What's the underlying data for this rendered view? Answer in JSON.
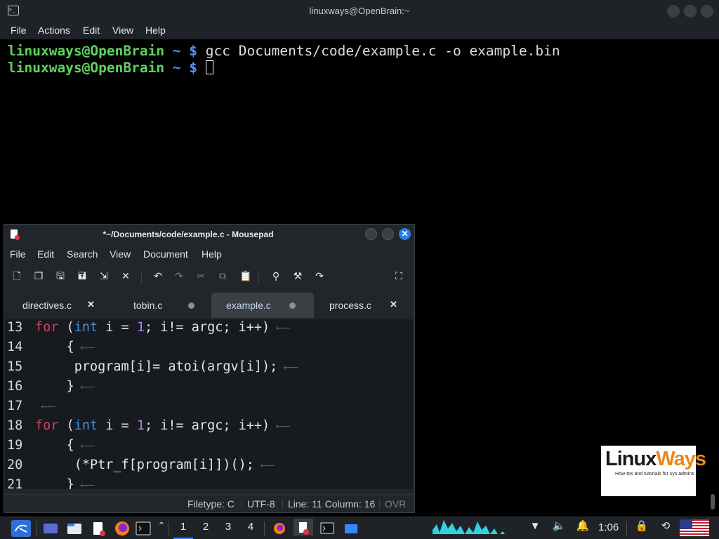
{
  "terminal": {
    "title": "linuxways@OpenBrain:~",
    "menu": [
      "File",
      "Actions",
      "Edit",
      "View",
      "Help"
    ],
    "lines": [
      {
        "user": "linuxways@OpenBrain",
        "path": " ~ $ ",
        "command": "gcc Documents/code/example.c -o example.bin"
      },
      {
        "user": "linuxways@OpenBrain",
        "path": " ~ $ ",
        "command": ""
      }
    ]
  },
  "mousepad": {
    "title": "*~/Documents/code/example.c - Mousepad",
    "menu": [
      "File",
      "Edit",
      "Search",
      "View",
      "Document",
      "Help"
    ],
    "tabs": [
      {
        "label": "directives.c",
        "state": "close"
      },
      {
        "label": "tobin.c",
        "state": "modified"
      },
      {
        "label": "example.c",
        "state": "modified",
        "active": true
      },
      {
        "label": "process.c",
        "state": "close"
      }
    ],
    "code": [
      {
        "n": "13",
        "indent": "",
        "parts": [
          [
            "kw",
            "for"
          ],
          [
            "",
            " ("
          ],
          [
            "ty",
            "int"
          ],
          [
            "",
            " i = "
          ],
          [
            "num",
            "1"
          ],
          [
            "",
            "; i!= argc; i++)"
          ]
        ]
      },
      {
        "n": "14",
        "indent": "    ",
        "parts": [
          [
            "",
            "{"
          ]
        ]
      },
      {
        "n": "15",
        "indent": "     ",
        "parts": [
          [
            "",
            "program[i]= atoi(argv[i]);"
          ]
        ]
      },
      {
        "n": "16",
        "indent": "    ",
        "parts": [
          [
            "",
            "}"
          ]
        ]
      },
      {
        "n": "17",
        "indent": "",
        "parts": []
      },
      {
        "n": "18",
        "indent": "",
        "parts": [
          [
            "kw",
            "for"
          ],
          [
            "",
            " ("
          ],
          [
            "ty",
            "int"
          ],
          [
            "",
            " i = "
          ],
          [
            "num",
            "1"
          ],
          [
            "",
            "; i!= argc; i++)"
          ]
        ]
      },
      {
        "n": "19",
        "indent": "    ",
        "parts": [
          [
            "",
            "{"
          ]
        ]
      },
      {
        "n": "20",
        "indent": "     ",
        "parts": [
          [
            "",
            "(*Ptr_f[program[i]])();"
          ]
        ]
      },
      {
        "n": "21",
        "indent": "    ",
        "parts": [
          [
            "",
            "}"
          ]
        ]
      }
    ],
    "status": {
      "filetype": "Filetype: C",
      "encoding": "UTF-8",
      "position": "Line: 11 Column: 16",
      "mode": "OVR"
    }
  },
  "logo": {
    "word1": "Linux",
    "word2": "Ways",
    "tagline": "How-tos and tutorials for sys admins"
  },
  "taskbar": {
    "workspaces": [
      "1",
      "2",
      "3",
      "4"
    ],
    "active_workspace": "1",
    "clock": "1:06"
  },
  "colors": {
    "accent": "#2b7be3",
    "prompt_user": "#5fd35f",
    "prompt_path": "#5c8cff"
  }
}
